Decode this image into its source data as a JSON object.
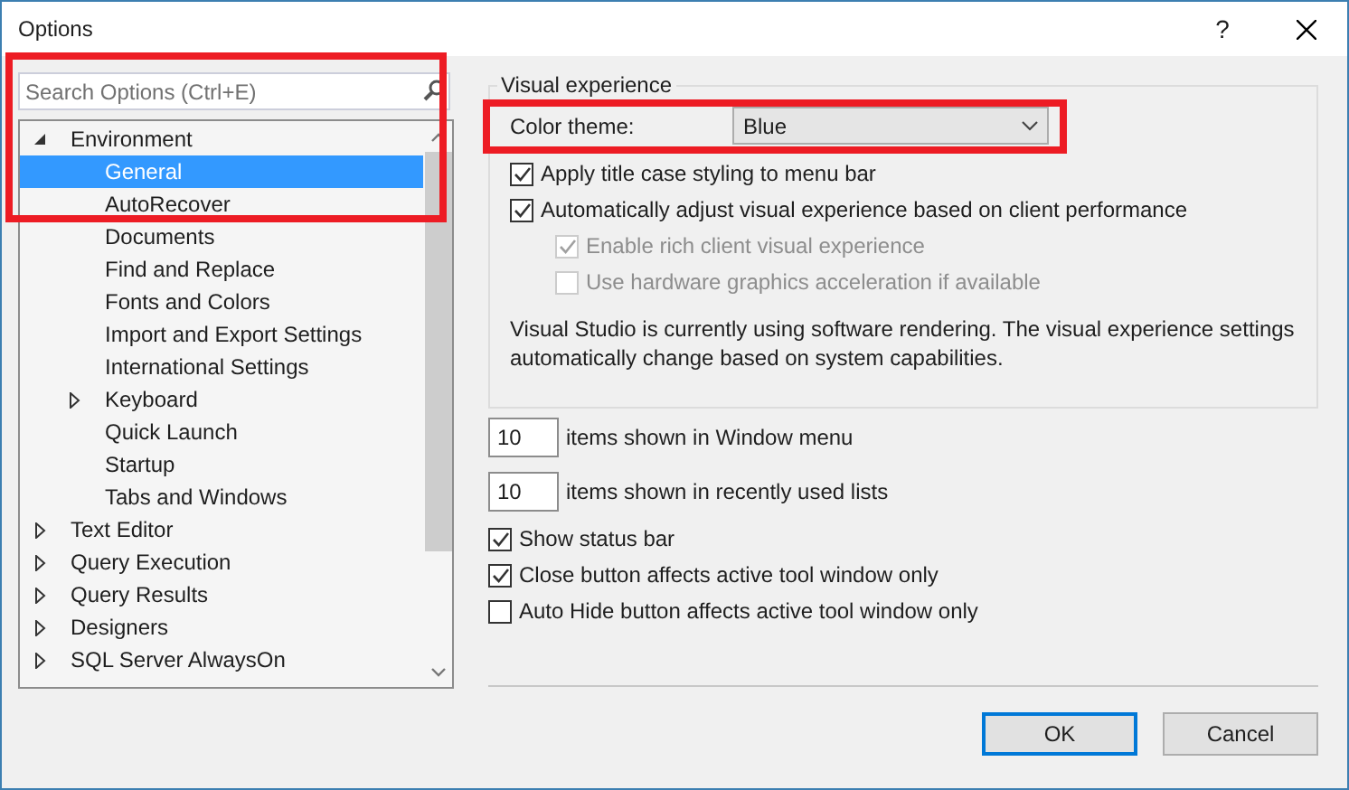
{
  "window": {
    "title": "Options",
    "help": "?"
  },
  "search": {
    "placeholder": "Search Options (Ctrl+E)"
  },
  "tree": [
    {
      "label": "Environment",
      "kind": "folder",
      "expanded": true,
      "selected": false,
      "children": [
        {
          "label": "General",
          "kind": "leaf",
          "selected": true
        },
        {
          "label": "AutoRecover",
          "kind": "leaf",
          "selected": false
        },
        {
          "label": "Documents",
          "kind": "leaf",
          "selected": false
        },
        {
          "label": "Find and Replace",
          "kind": "leaf",
          "selected": false
        },
        {
          "label": "Fonts and Colors",
          "kind": "leaf",
          "selected": false
        },
        {
          "label": "Import and Export Settings",
          "kind": "leaf",
          "selected": false
        },
        {
          "label": "International Settings",
          "kind": "leaf",
          "selected": false
        },
        {
          "label": "Keyboard",
          "kind": "folder",
          "expanded": false,
          "selected": false
        },
        {
          "label": "Quick Launch",
          "kind": "leaf",
          "selected": false
        },
        {
          "label": "Startup",
          "kind": "leaf",
          "selected": false
        },
        {
          "label": "Tabs and Windows",
          "kind": "leaf",
          "selected": false
        }
      ]
    },
    {
      "label": "Text Editor",
      "kind": "folder",
      "expanded": false,
      "selected": false
    },
    {
      "label": "Query Execution",
      "kind": "folder",
      "expanded": false,
      "selected": false
    },
    {
      "label": "Query Results",
      "kind": "folder",
      "expanded": false,
      "selected": false
    },
    {
      "label": "Designers",
      "kind": "folder",
      "expanded": false,
      "selected": false
    },
    {
      "label": "SQL Server AlwaysOn",
      "kind": "folder",
      "expanded": false,
      "selected": false
    }
  ],
  "visual_experience": {
    "title": "Visual experience",
    "color_theme_label": "Color theme:",
    "color_theme_value": "Blue",
    "options": [
      {
        "label": "Apply title case styling to menu bar",
        "checked": true,
        "disabled": false
      },
      {
        "label": "Automatically adjust visual experience based on client performance",
        "checked": true,
        "disabled": false,
        "children": [
          {
            "label": "Enable rich client visual experience",
            "checked": true,
            "disabled": true
          },
          {
            "label": "Use hardware graphics acceleration if available",
            "checked": false,
            "disabled": true
          }
        ]
      }
    ],
    "note": "Visual Studio is currently using software rendering.  The visual experience settings automatically change based on system capabilities."
  },
  "counts": [
    {
      "value": "10",
      "label": "items shown in Window menu"
    },
    {
      "value": "10",
      "label": "items shown in recently used lists"
    }
  ],
  "options": [
    {
      "label": "Show status bar",
      "checked": true
    },
    {
      "label": "Close button affects active tool window only",
      "checked": true
    },
    {
      "label": "Auto Hide button affects active tool window only",
      "checked": false
    }
  ],
  "buttons": [
    {
      "label": "OK",
      "default": true
    },
    {
      "label": "Cancel",
      "default": false
    }
  ]
}
